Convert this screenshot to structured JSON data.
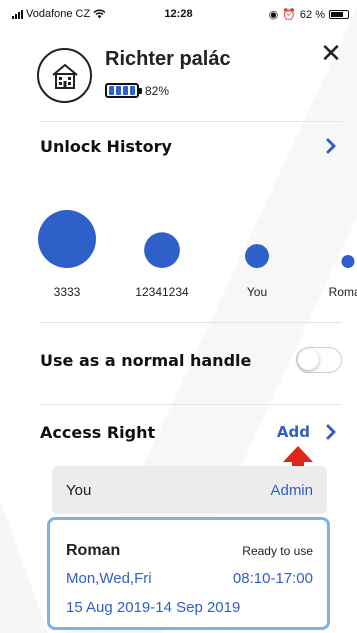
{
  "status_bar": {
    "carrier": "Vodafone CZ",
    "time": "12:28",
    "battery_percent": "62 %"
  },
  "header": {
    "title": "Richter palác",
    "battery_label": "82%",
    "battery_level": 0.82,
    "close_label": "✕"
  },
  "unlock_history": {
    "label": "Unlock History",
    "users": [
      {
        "name": "3333",
        "count_level": 1.0
      },
      {
        "name": "12341234",
        "count_level": 0.38
      },
      {
        "name": "You",
        "count_level": 0.17
      },
      {
        "name": "Roman",
        "count_level": 0.05
      }
    ]
  },
  "normal_handle": {
    "label": "Use as a normal handle",
    "enabled": false
  },
  "access_right": {
    "label": "Access Right",
    "add_label": "Add",
    "entries": [
      {
        "name": "You",
        "role": "Admin"
      },
      {
        "name": "Roman",
        "status": "Ready to use",
        "days": "Mon,Wed,Fri",
        "time": "08:10-17:00",
        "date_range": "15 Aug 2019-14 Sep 2019"
      }
    ]
  },
  "colors": {
    "accent": "#2f5fc9",
    "highlight_border": "#7fb3df",
    "annotation_arrow": "#e0261b"
  }
}
